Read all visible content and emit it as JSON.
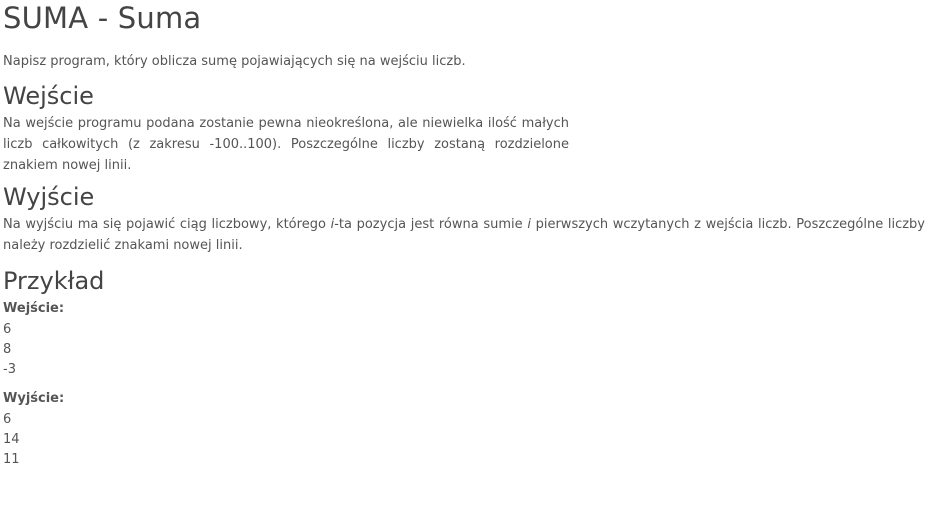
{
  "title": "SUMA - Suma",
  "intro": "Napisz program, który oblicza sumę pojawiających się na wejściu liczb.",
  "input_section": {
    "heading": "Wejście",
    "text": "Na wejście programu podana zostanie pewna nieokreślona, ale niewielka ilość małych liczb całkowitych (z zakresu -100..100). Poszczególne liczby zostaną rozdzielone znakiem nowej linii."
  },
  "output_section": {
    "heading": "Wyjście",
    "text_part1": "Na wyjściu ma się pojawić ciąg liczbowy, którego ",
    "italic_i1": "i",
    "text_part2": "-ta pozycja jest równa sumie ",
    "italic_i2": "i",
    "text_part3": " pierwszych wczytanych z wejścia liczb. Poszczególne liczby należy rozdzielić znakami nowej linii."
  },
  "example_section": {
    "heading": "Przykład",
    "input_label": "Wejście:",
    "input_lines": [
      "6",
      "8",
      "-3"
    ],
    "output_label": "Wyjście:",
    "output_lines": [
      "6",
      "14",
      "11"
    ]
  }
}
